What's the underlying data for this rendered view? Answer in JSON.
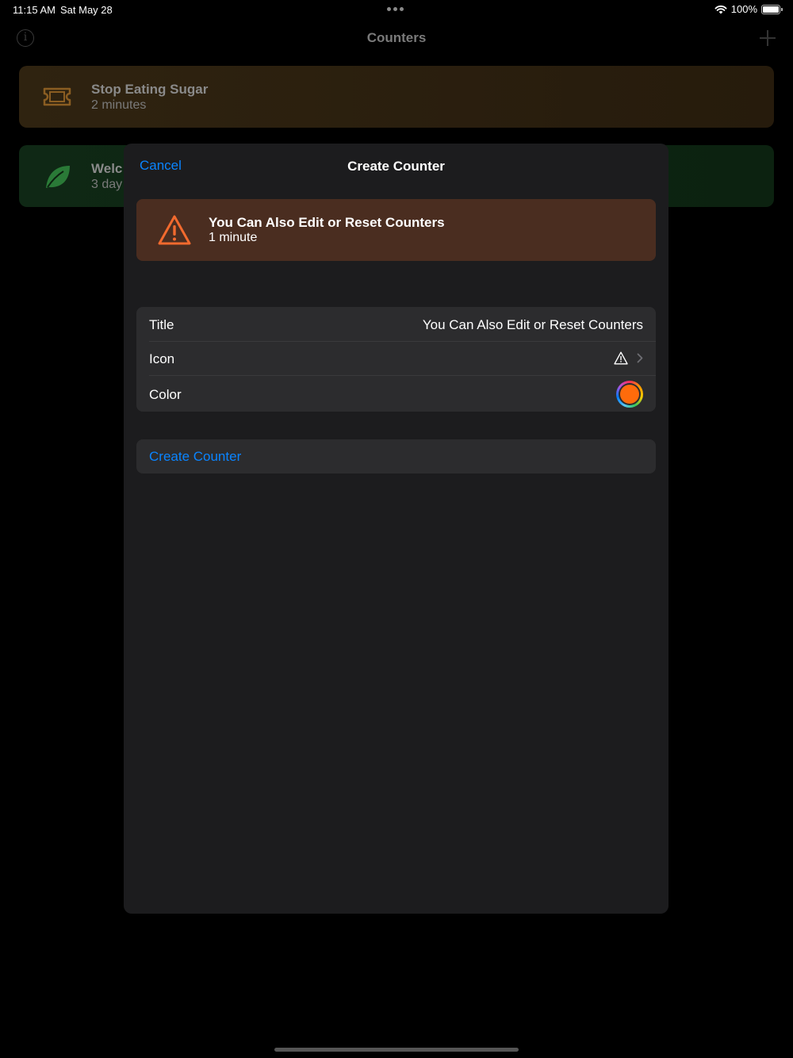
{
  "status_bar": {
    "time": "11:15 AM",
    "date": "Sat May 28",
    "battery": "100%",
    "battery_level": 1.0
  },
  "background": {
    "title": "Counters",
    "counters": [
      {
        "title": "Stop Eating Sugar",
        "subtitle": "2 minutes",
        "icon": "ticket-icon",
        "color": "#a06a22"
      },
      {
        "title": "Welc",
        "subtitle": "3 day",
        "icon": "leaf-icon",
        "color": "#2f9c45"
      }
    ]
  },
  "modal": {
    "cancel_label": "Cancel",
    "title": "Create Counter",
    "preview": {
      "title": "You Can Also Edit or Reset Counters",
      "subtitle": "1 minute",
      "icon": "warning-triangle-icon",
      "color": "#f26a2e"
    },
    "form": {
      "title_label": "Title",
      "title_value": "You Can Also Edit or Reset Counters",
      "icon_label": "Icon",
      "icon_value": "warning-triangle-icon",
      "color_label": "Color",
      "color_value": "#ff6b0b"
    },
    "create_label": "Create Counter"
  },
  "colors": {
    "accent": "#0a84ff",
    "modal_bg": "#1c1c1e",
    "row_bg": "#2c2c2e"
  }
}
